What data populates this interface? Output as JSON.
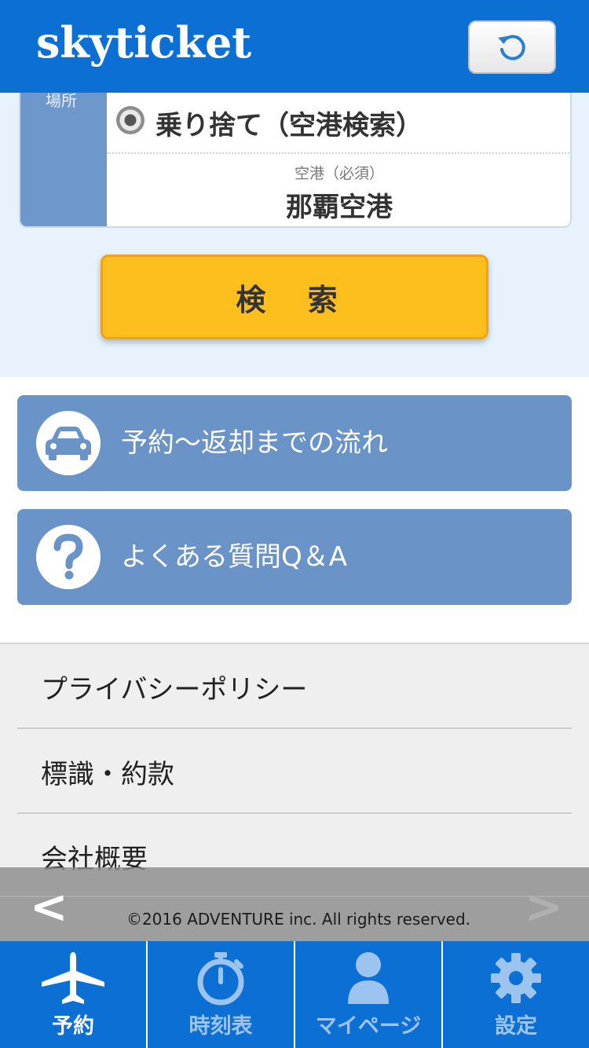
{
  "header": {
    "logo": "skyticket",
    "reload_icon": "reload-icon"
  },
  "search": {
    "side_label": "場所",
    "dropoff_option": "乗り捨て（空港検索）",
    "airport_caption": "空港（必須）",
    "airport_value": "那覇空港",
    "search_button": "検 索"
  },
  "info": {
    "flow_label": "予約～返却までの流れ",
    "faq_label": "よくある質問Q＆A",
    "flow_icon": "car-icon",
    "faq_icon": "question-icon"
  },
  "links": [
    {
      "label": "プライバシーポリシー"
    },
    {
      "label": "標識・約款"
    },
    {
      "label": "会社概要"
    }
  ],
  "browser": {
    "back": "<",
    "forward": ">",
    "copyright": "©2016 ADVENTURE inc. All rights reserved."
  },
  "tabs": [
    {
      "label": "予約",
      "icon": "airplane-icon",
      "active": true
    },
    {
      "label": "時刻表",
      "icon": "stopwatch-icon",
      "active": false
    },
    {
      "label": "マイページ",
      "icon": "person-icon",
      "active": false
    },
    {
      "label": "設定",
      "icon": "gear-icon",
      "active": false
    }
  ],
  "colors": {
    "brand_blue": "#0b6fd4",
    "search_yellow": "#fcbf1d",
    "info_blue": "#6a93c8"
  }
}
